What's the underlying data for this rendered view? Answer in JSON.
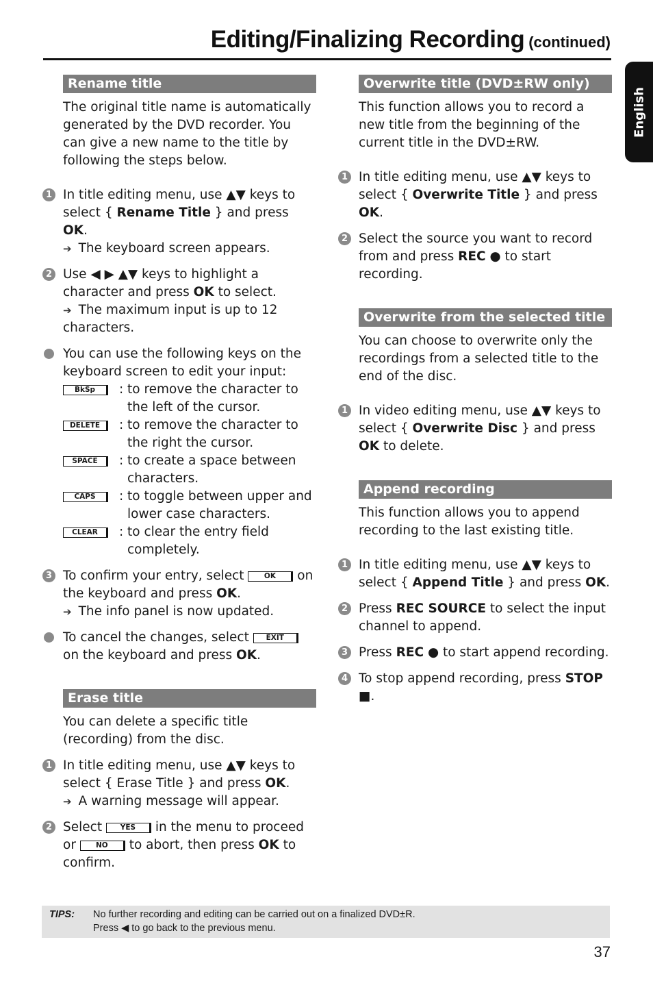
{
  "header": {
    "title": "Editing/Finalizing Recording",
    "continued": "(continued)"
  },
  "side_tab": {
    "label": "English"
  },
  "symbols": {
    "updown": "▲▼",
    "left": "◀",
    "right": "▶",
    "arrow": "➔",
    "rec": "●",
    "stop": "■",
    "back": "◀"
  },
  "rename": {
    "heading": "Rename title",
    "intro": "The original title name is automatically generated by the DVD recorder. You can give a new name to the title by following the steps below.",
    "step1": {
      "n": "1",
      "a": "In title editing menu, use ",
      "b": " keys to select { ",
      "bold": "Rename Title",
      "c": " } and press ",
      "ok": "OK",
      "d": ".",
      "result": "The keyboard screen appears."
    },
    "step2": {
      "n": "2",
      "a": "Use ",
      "b": " keys to highlight a character and press ",
      "ok": "OK",
      "c": " to select.",
      "result": "The maximum input is up to 12 characters."
    },
    "note1": "You can use the following keys on the keyboard screen to edit your input:",
    "keys": [
      {
        "key": "BkSp",
        "desc": "to remove the character to the left of the cursor."
      },
      {
        "key": "DELETE",
        "desc": "to remove the character to the right the cursor."
      },
      {
        "key": "SPACE",
        "desc": "to create a space between characters."
      },
      {
        "key": "CAPS",
        "desc": "to toggle between upper and lower case characters."
      },
      {
        "key": "CLEAR",
        "desc": "to clear the entry field completely."
      }
    ],
    "step3": {
      "n": "3",
      "a": "To confirm your entry, select ",
      "key": "OK",
      "b": " on the keyboard and press ",
      "ok": "OK",
      "c": ".",
      "result": "The info panel is now updated."
    },
    "note2": {
      "a": "To cancel the changes, select ",
      "key": "EXIT",
      "b": " on the keyboard and press ",
      "ok": "OK",
      "c": "."
    }
  },
  "erase": {
    "heading": "Erase title",
    "intro": "You can delete a specific title (recording) from the disc.",
    "step1": {
      "n": "1",
      "a": "In title editing menu, use ",
      "b": " keys to select { Erase Title } and press ",
      "ok": "OK",
      "c": ".",
      "result": "A warning message will appear."
    },
    "step2": {
      "n": "2",
      "a": "Select ",
      "key_yes": "YES",
      "b": " in the menu to proceed or ",
      "key_no": "NO",
      "c": " to abort, then press ",
      "ok": "OK",
      "d": " to confirm."
    }
  },
  "overwrite": {
    "heading": "Overwrite title (DVD±RW only)",
    "intro": "This function allows you to record a new title from the beginning of the current title in the DVD±RW.",
    "step1": {
      "n": "1",
      "a": "In title editing menu, use ",
      "b": " keys to select { ",
      "bold": "Overwrite Title",
      "c": " } and press ",
      "ok": "OK",
      "d": "."
    },
    "step2": {
      "n": "2",
      "a": "Select the source you want to record from and press ",
      "rec": "REC",
      "b": " to start recording."
    }
  },
  "overwrite_selected": {
    "heading": "Overwrite from the selected title",
    "intro": "You can choose to overwrite only the recordings from a selected title to the end of the disc.",
    "step1": {
      "n": "1",
      "a": "In video editing menu, use ",
      "b": " keys to select { ",
      "bold": "Overwrite Disc",
      "c": " } and press ",
      "ok": "OK",
      "d": " to delete."
    }
  },
  "append": {
    "heading": "Append recording",
    "intro": "This function allows you to append recording to the last existing title.",
    "step1": {
      "n": "1",
      "a": "In title editing menu, use ",
      "b": " keys to select { ",
      "bold": "Append Title",
      "c": " } and press ",
      "ok": "OK",
      "d": "."
    },
    "step2": {
      "n": "2",
      "a": "Press ",
      "bold": "REC SOURCE",
      "b": " to select the input channel to append."
    },
    "step3": {
      "n": "3",
      "a": "Press ",
      "rec": "REC",
      "b": " to start append recording."
    },
    "step4": {
      "n": "4",
      "a": "To stop append recording, press ",
      "stop": "STOP",
      "b": "."
    }
  },
  "tips": {
    "label": "TIPS:",
    "line1": "No further recording and editing can be carried out on a finalized DVD±R.",
    "line2a": "Press ",
    "line2b": " to go back to the previous menu."
  },
  "page_number": "37"
}
